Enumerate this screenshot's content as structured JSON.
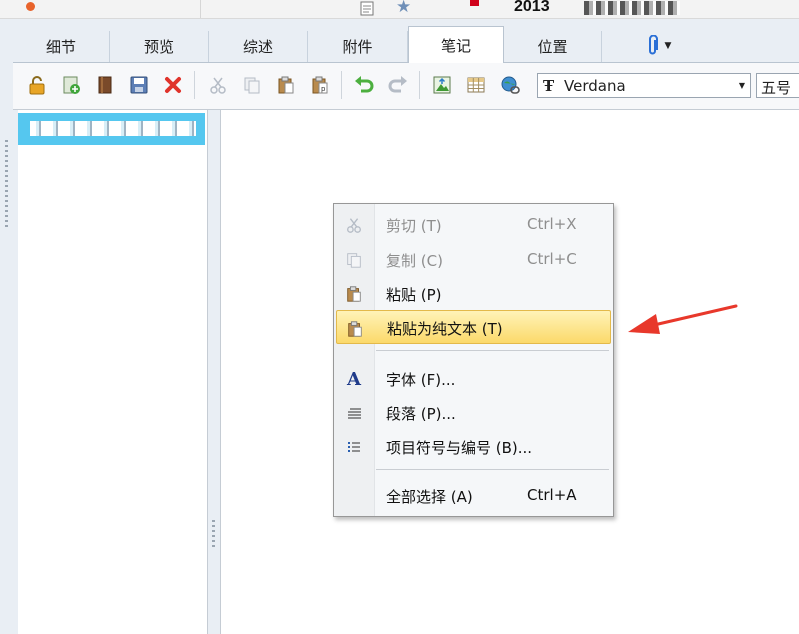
{
  "title_bar": {
    "year": "2013"
  },
  "tabs": [
    {
      "label": "细节",
      "active": false
    },
    {
      "label": "预览",
      "active": false
    },
    {
      "label": "综述",
      "active": false
    },
    {
      "label": "附件",
      "active": false
    },
    {
      "label": "笔记",
      "active": true
    },
    {
      "label": "位置",
      "active": false
    }
  ],
  "toolbar": {
    "icons": [
      "lock-icon",
      "new-note-icon",
      "book-icon",
      "save-icon",
      "delete-icon",
      "cut-icon",
      "copy-icon",
      "paste-icon",
      "paste-plain-icon",
      "undo-icon",
      "redo-icon",
      "insert-image-icon",
      "insert-table-icon",
      "insert-link-icon"
    ],
    "font_name": "Verdana",
    "font_size": "五号"
  },
  "context_menu": {
    "items": [
      {
        "label": "剪切 (T)",
        "shortcut": "Ctrl+X",
        "icon": "cut-icon",
        "disabled": true
      },
      {
        "label": "复制 (C)",
        "shortcut": "Ctrl+C",
        "icon": "copy-icon",
        "disabled": true
      },
      {
        "label": "粘贴 (P)",
        "shortcut": "",
        "icon": "paste-icon",
        "disabled": false
      },
      {
        "label": "粘贴为纯文本 (T)",
        "shortcut": "",
        "icon": "paste-plain-icon",
        "disabled": false,
        "highlighted": true
      },
      {
        "label": "字体 (F)...",
        "shortcut": "",
        "icon": "font-icon",
        "disabled": false
      },
      {
        "label": "段落 (P)...",
        "shortcut": "",
        "icon": "paragraph-icon",
        "disabled": false
      },
      {
        "label": "项目符号与编号 (B)...",
        "shortcut": "",
        "icon": "bullets-icon",
        "disabled": false
      },
      {
        "label": "全部选择 (A)",
        "shortcut": "Ctrl+A",
        "icon": "",
        "disabled": false
      }
    ]
  },
  "colors": {
    "selection": "#55c7ef",
    "highlight": "#fbd96a",
    "arrow": "#e8382b"
  }
}
